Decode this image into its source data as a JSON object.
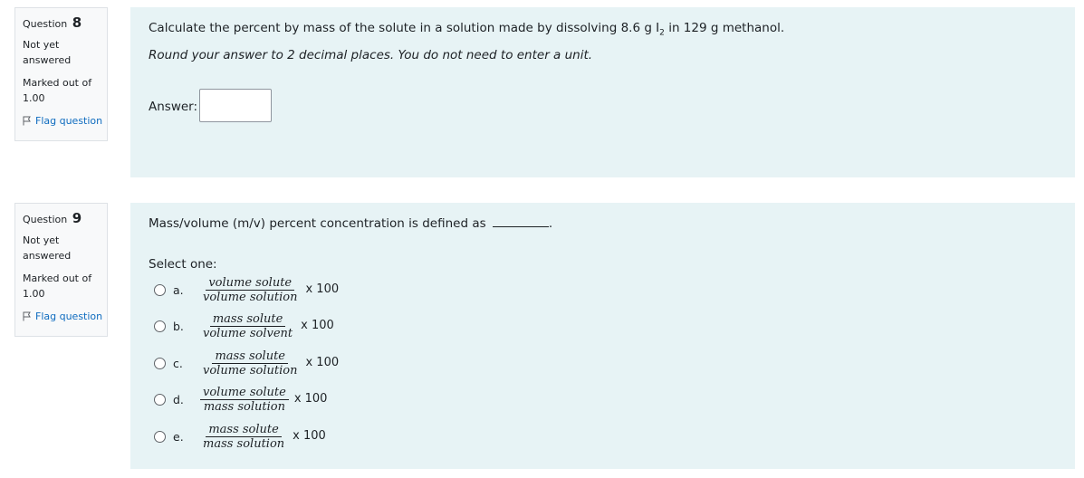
{
  "q8": {
    "label": "Question",
    "number": "8",
    "state_line1": "Not yet",
    "state_line2": "answered",
    "grade_line1": "Marked out of",
    "grade_line2": "1.00",
    "flag": "Flag question",
    "text_before": "Calculate the percent by mass of the solute in a solution made by dissolving 8.6 g I",
    "text_sub": "2",
    "text_after": " in 129 g methanol.",
    "instruction": "Round your answer to 2 decimal places.  You do not need to enter a unit.",
    "answer_label": "Answer:",
    "answer_value": ""
  },
  "q9": {
    "label": "Question",
    "number": "9",
    "state_line1": "Not yet",
    "state_line2": "answered",
    "grade_line1": "Marked out of",
    "grade_line2": "1.00",
    "flag": "Flag question",
    "text": "Mass/volume (m/v) percent concentration is defined as",
    "text_end": ".",
    "select_one": "Select one:",
    "options": [
      {
        "letter": "a.",
        "num": "volume solute",
        "den": "volume solution",
        "times": "x 100"
      },
      {
        "letter": "b.",
        "num": "mass solute",
        "den": "volume solvent",
        "times": "x 100"
      },
      {
        "letter": "c.",
        "num": "mass solute",
        "den": "volume solution",
        "times": "x 100"
      },
      {
        "letter": "d.",
        "num": "volume solute",
        "den": "mass solution",
        "times": "x 100"
      },
      {
        "letter": "e.",
        "num": "mass solute",
        "den": "mass solution",
        "times": "x 100"
      }
    ]
  },
  "icons": {
    "flag": "flag-icon",
    "radio": "radio-unchecked-icon"
  },
  "colors": {
    "link": "#0f6cbf",
    "content_bg": "#e7f3f5",
    "info_bg": "#f8f9fa"
  }
}
